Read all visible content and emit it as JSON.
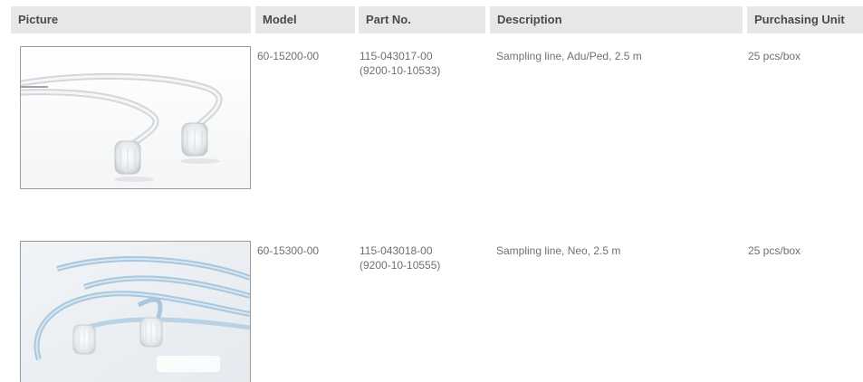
{
  "table": {
    "headers": {
      "picture": "Picture",
      "model": "Model",
      "part_no": "Part No.",
      "description": "Description",
      "purchasing_unit": "Purchasing Unit"
    },
    "rows": [
      {
        "picture_icon": "sampling-line-adult-photo",
        "model": "60-15200-00",
        "part_no_line1": "115-043017-00",
        "part_no_line2": "(9200-10-10533)",
        "description": "Sampling line, Adu/Ped, 2.5 m",
        "purchasing_unit": "25 pcs/box"
      },
      {
        "picture_icon": "sampling-line-neonatal-photo",
        "model": "60-15300-00",
        "part_no_line1": "115-043018-00",
        "part_no_line2": "(9200-10-10555)",
        "description": "Sampling line, Neo, 2.5 m",
        "purchasing_unit": "25 pcs/box"
      }
    ]
  },
  "colors": {
    "header_bg": "#e7e7e7",
    "header_text": "#4a4a4a",
    "body_text": "#707070",
    "tube_blue": "#a9c7de"
  }
}
